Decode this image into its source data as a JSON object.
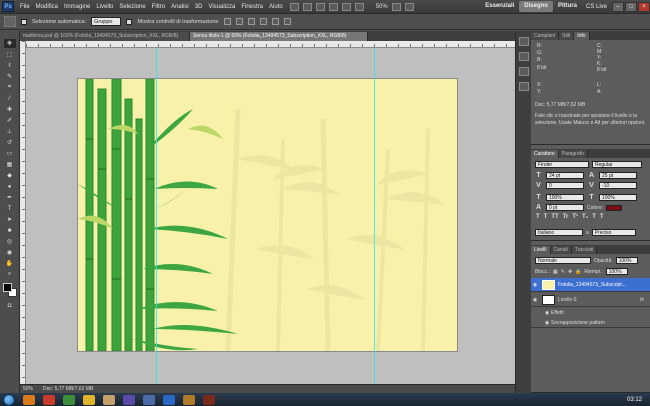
{
  "menubar": {
    "logo": "Ps",
    "items": [
      "File",
      "Modifica",
      "Immagine",
      "Livello",
      "Selezione",
      "Filtro",
      "Analisi",
      "3D",
      "Visualizza",
      "Finestra",
      "Aiuto"
    ],
    "zoom": "50%",
    "workspaces": [
      "Essenziali",
      "Disegno",
      "Pittura"
    ],
    "active_workspace": "Disegno",
    "cs_live": "CS Live"
  },
  "options": {
    "auto_select_label": "Selezione automatica:",
    "auto_select_value": "Gruppo",
    "show_transform_label": "Mostra controlli di trasformazione"
  },
  "doc_tabs": [
    {
      "label": "matilsma.psd @ 100% (Fotolia_13494573_Subscription_XXL, RGB/8)",
      "active": false
    },
    {
      "label": "Senza titolo-1 @ 50% (Fotolia_13494573_Subscription_XXL, RGB/8)",
      "active": true
    }
  ],
  "status": {
    "zoom": "50%",
    "doc": "Doc: 5,77 MB/7,62 MB"
  },
  "info_panel": {
    "tabs": [
      "Campioni",
      "Stili",
      "Info"
    ],
    "active_tab": "Info",
    "labels": {
      "r": "R:",
      "g": "G:",
      "b": "B:",
      "c": "C:",
      "m": "M:",
      "y": "Y:",
      "k": "K:",
      "x": "X:",
      "yy": "Y:",
      "w": "L:",
      "h": "A:",
      "bits_left": "8 bit",
      "bits_right": "8 bit"
    },
    "doc": "Doc: 5,77 MB/7,62 MB",
    "hint": "Fate clic e trascinate per spostare il livello o la selezione. Usate Maiusc e Alt per ulteriori opzioni."
  },
  "character_panel": {
    "tabs": [
      "Carattere",
      "Paragrafo"
    ],
    "active_tab": "Carattere",
    "font_family": "Finder",
    "font_style": "Regular",
    "font_size": "24 pt",
    "leading": "25 pt",
    "kerning": "0",
    "tracking": "-10",
    "vertical_scale": "100%",
    "horizontal_scale": "100%",
    "baseline_shift": "0 pt",
    "color_label": "Colore:",
    "color": "#7a0e12",
    "language": "Italiano",
    "antialias": "Preciso",
    "aa_label": "a",
    "style_buttons": [
      "T",
      "T",
      "TT",
      "Tr",
      "T¹",
      "T₁",
      "T",
      "T"
    ]
  },
  "layers_panel": {
    "tabs": [
      "Livelli",
      "Canali",
      "Tracciati"
    ],
    "active_tab": "Livelli",
    "blend_mode": "Normale",
    "opacity_label": "Opacità:",
    "opacity": "100%",
    "lock_label": "Blocc.:",
    "fill_label": "Riempi.:",
    "fill": "100%",
    "layers": [
      {
        "name": "Fotolia_13494573_Subscript...",
        "selected": true,
        "fx": ""
      },
      {
        "name": "Livello 0",
        "selected": false,
        "fx": "fx"
      }
    ],
    "effects_label": "Effetti",
    "effect": "Sovrapposizione pattern"
  },
  "taskbar": {
    "clock": "03:12"
  }
}
